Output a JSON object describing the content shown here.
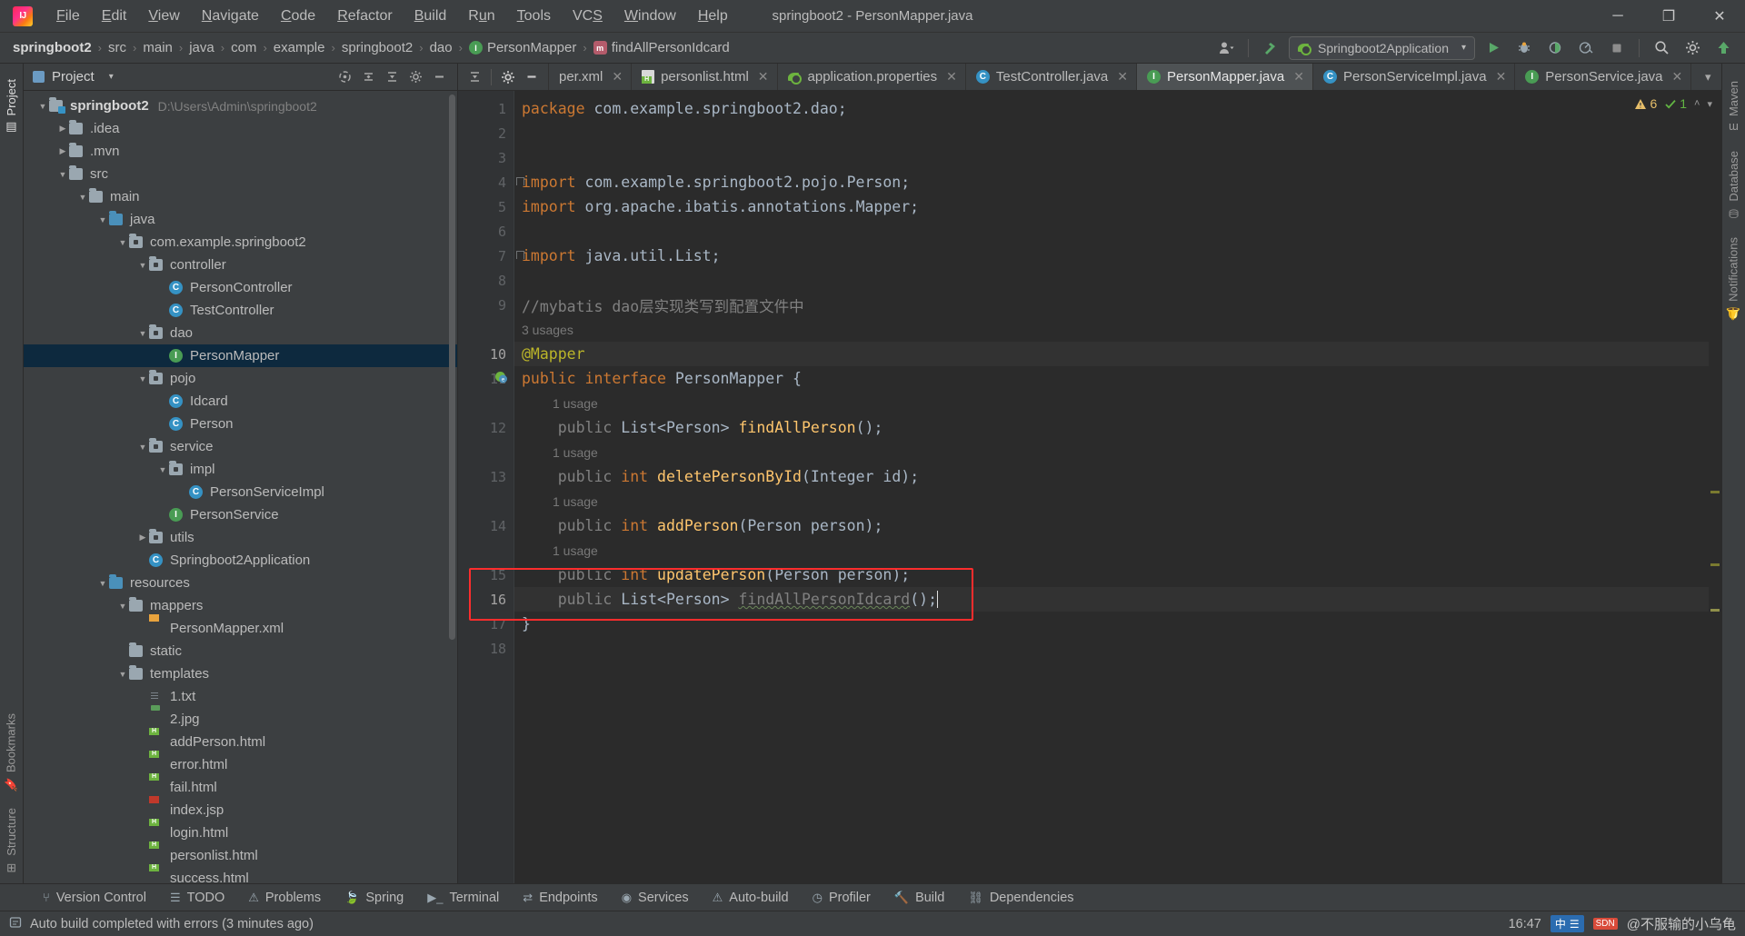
{
  "window": {
    "title": "springboot2 - PersonMapper.java",
    "logo_icon": "intellij-idea-logo",
    "controls": {
      "minimize": "─",
      "maximize": "❐",
      "close": "✕"
    }
  },
  "menubar": {
    "items": [
      {
        "label": "File",
        "mnemonic": "F"
      },
      {
        "label": "Edit",
        "mnemonic": "E"
      },
      {
        "label": "View",
        "mnemonic": "V"
      },
      {
        "label": "Navigate",
        "mnemonic": "N"
      },
      {
        "label": "Code",
        "mnemonic": "C"
      },
      {
        "label": "Refactor",
        "mnemonic": "R"
      },
      {
        "label": "Build",
        "mnemonic": "B"
      },
      {
        "label": "Run",
        "mnemonic": "u"
      },
      {
        "label": "Tools",
        "mnemonic": "T"
      },
      {
        "label": "VCS",
        "mnemonic": "S"
      },
      {
        "label": "Window",
        "mnemonic": "W"
      },
      {
        "label": "Help",
        "mnemonic": "H"
      }
    ]
  },
  "breadcrumbs": {
    "items": [
      {
        "label": "springboot2",
        "icon": null,
        "root": true
      },
      {
        "label": "src",
        "icon": null
      },
      {
        "label": "main",
        "icon": null
      },
      {
        "label": "java",
        "icon": null
      },
      {
        "label": "com",
        "icon": null
      },
      {
        "label": "example",
        "icon": null
      },
      {
        "label": "springboot2",
        "icon": null
      },
      {
        "label": "dao",
        "icon": null
      },
      {
        "label": "PersonMapper",
        "icon": "interface-icon"
      },
      {
        "label": "findAllPersonIdcard",
        "icon": "method-icon"
      }
    ],
    "separator": "›"
  },
  "toolbar": {
    "account_icon": "user-account-icon",
    "account_caret": "▾",
    "build_hammer_icon": "hammer-icon",
    "run_config": {
      "icon": "spring-boot-icon",
      "label": "Springboot2Application",
      "caret": "▾"
    },
    "run_icon": "run-play-icon",
    "debug_icon": "debug-bug-icon",
    "run_with_coverage_icon": "run-coverage-icon",
    "profiler_icon": "profiler-icon",
    "stop_icon": "stop-square-icon",
    "search_icon": "search-magnifier-icon",
    "settings_icon": "settings-gear-icon",
    "updates_icon": "green-arrow-icon"
  },
  "left_strip": {
    "tabs": [
      {
        "label": "Project",
        "icon": "project-folder-icon",
        "selected": true
      },
      {
        "label": "Bookmarks",
        "icon": "bookmark-icon",
        "selected": false
      },
      {
        "label": "Structure",
        "icon": "structure-icon",
        "selected": false
      }
    ]
  },
  "right_strip": {
    "tabs": [
      {
        "label": "Maven",
        "icon": "maven-icon"
      },
      {
        "label": "Database",
        "icon": "database-icon"
      },
      {
        "label": "Notifications",
        "icon": "notification-bell-icon"
      }
    ]
  },
  "project_panel": {
    "title": "Project",
    "title_caret": "▾",
    "actions": [
      {
        "icon": "sync-icon",
        "name": "reload-from-disk"
      },
      {
        "icon": "collapse-all-icon",
        "name": "collapse-all"
      },
      {
        "icon": "select-opened-file-icon",
        "name": "select-opened-file"
      },
      {
        "icon": "settings-gear-icon",
        "name": "project-settings"
      },
      {
        "icon": "hide-icon",
        "name": "hide-panel"
      }
    ],
    "tree": [
      {
        "label": "springboot2",
        "path": "D:\\Users\\Admin\\springboot2",
        "depth": 0,
        "arrow": "down",
        "icon": "module-folder",
        "bold": true,
        "selected": false
      },
      {
        "label": ".idea",
        "depth": 1,
        "arrow": "right",
        "icon": "folder",
        "selected": false
      },
      {
        "label": ".mvn",
        "depth": 1,
        "arrow": "right",
        "icon": "folder",
        "selected": false
      },
      {
        "label": "src",
        "depth": 1,
        "arrow": "down",
        "icon": "folder",
        "selected": false
      },
      {
        "label": "main",
        "depth": 2,
        "arrow": "down",
        "icon": "folder",
        "selected": false
      },
      {
        "label": "java",
        "depth": 3,
        "arrow": "down",
        "icon": "source-folder",
        "selected": false
      },
      {
        "label": "com.example.springboot2",
        "depth": 4,
        "arrow": "down",
        "icon": "package",
        "selected": false
      },
      {
        "label": "controller",
        "depth": 5,
        "arrow": "down",
        "icon": "package",
        "selected": false
      },
      {
        "label": "PersonController",
        "depth": 6,
        "arrow": "none",
        "icon": "class",
        "selected": false
      },
      {
        "label": "TestController",
        "depth": 6,
        "arrow": "none",
        "icon": "class",
        "selected": false
      },
      {
        "label": "dao",
        "depth": 5,
        "arrow": "down",
        "icon": "package",
        "selected": false
      },
      {
        "label": "PersonMapper",
        "depth": 6,
        "arrow": "none",
        "icon": "interface",
        "selected": true
      },
      {
        "label": "pojo",
        "depth": 5,
        "arrow": "down",
        "icon": "package",
        "selected": false
      },
      {
        "label": "Idcard",
        "depth": 6,
        "arrow": "none",
        "icon": "class",
        "selected": false
      },
      {
        "label": "Person",
        "depth": 6,
        "arrow": "none",
        "icon": "class",
        "selected": false
      },
      {
        "label": "service",
        "depth": 5,
        "arrow": "down",
        "icon": "package",
        "selected": false
      },
      {
        "label": "impl",
        "depth": 6,
        "arrow": "down",
        "icon": "package",
        "selected": false
      },
      {
        "label": "PersonServiceImpl",
        "depth": 7,
        "arrow": "none",
        "icon": "class",
        "selected": false
      },
      {
        "label": "PersonService",
        "depth": 6,
        "arrow": "none",
        "icon": "interface",
        "selected": false
      },
      {
        "label": "utils",
        "depth": 5,
        "arrow": "right",
        "icon": "package",
        "selected": false
      },
      {
        "label": "Springboot2Application",
        "depth": 5,
        "arrow": "none",
        "icon": "class",
        "selected": false
      },
      {
        "label": "resources",
        "depth": 3,
        "arrow": "down",
        "icon": "source-folder",
        "selected": false
      },
      {
        "label": "mappers",
        "depth": 4,
        "arrow": "down",
        "icon": "folder",
        "selected": false
      },
      {
        "label": "PersonMapper.xml",
        "depth": 5,
        "arrow": "none",
        "icon": "xml",
        "selected": false
      },
      {
        "label": "static",
        "depth": 4,
        "arrow": "none",
        "icon": "folder",
        "selected": false
      },
      {
        "label": "templates",
        "depth": 4,
        "arrow": "down",
        "icon": "folder",
        "selected": false
      },
      {
        "label": "1.txt",
        "depth": 5,
        "arrow": "none",
        "icon": "txt",
        "selected": false
      },
      {
        "label": "2.jpg",
        "depth": 5,
        "arrow": "none",
        "icon": "jpg",
        "selected": false
      },
      {
        "label": "addPerson.html",
        "depth": 5,
        "arrow": "none",
        "icon": "html",
        "selected": false
      },
      {
        "label": "error.html",
        "depth": 5,
        "arrow": "none",
        "icon": "html",
        "selected": false
      },
      {
        "label": "fail.html",
        "depth": 5,
        "arrow": "none",
        "icon": "html",
        "selected": false
      },
      {
        "label": "index.jsp",
        "depth": 5,
        "arrow": "none",
        "icon": "jsp",
        "selected": false
      },
      {
        "label": "login.html",
        "depth": 5,
        "arrow": "none",
        "icon": "html",
        "selected": false
      },
      {
        "label": "personlist.html",
        "depth": 5,
        "arrow": "none",
        "icon": "html",
        "selected": false
      },
      {
        "label": "success.html",
        "depth": 5,
        "arrow": "none",
        "icon": "html",
        "selected": false
      }
    ]
  },
  "editor": {
    "tabs": [
      {
        "label": "per.xml",
        "icon": "xml-icon",
        "active": false,
        "truncated": true
      },
      {
        "label": "personlist.html",
        "icon": "html-icon",
        "active": false
      },
      {
        "label": "application.properties",
        "icon": "spring-icon",
        "active": false
      },
      {
        "label": "TestController.java",
        "icon": "class-icon",
        "active": false
      },
      {
        "label": "PersonMapper.java",
        "icon": "interface-icon",
        "active": true
      },
      {
        "label": "PersonServiceImpl.java",
        "icon": "class-icon",
        "active": false
      },
      {
        "label": "PersonService.java",
        "icon": "interface-icon",
        "active": false
      }
    ],
    "tab_close": "✕",
    "tab_overflow_left": "‹",
    "tab_list_icon": "▾",
    "tab_more_icon": "⋮",
    "inspection": {
      "warning_count": "6",
      "warning_icon": "warning-triangle-icon",
      "error_fixed_count": "1",
      "check_icon": "checkmark-icon",
      "caret_down": "▾",
      "caret_up": "˄"
    },
    "lines": [
      {
        "num": "1",
        "segments": [
          {
            "t": "package ",
            "c": "kw"
          },
          {
            "t": "com.example.springboot2.dao;",
            "c": "typ"
          }
        ]
      },
      {
        "num": "2",
        "segments": []
      },
      {
        "num": "3",
        "segments": []
      },
      {
        "num": "4",
        "fold": true,
        "segments": [
          {
            "t": "import ",
            "c": "kw"
          },
          {
            "t": "com.example.springboot2.pojo.Person;",
            "c": "typ"
          }
        ]
      },
      {
        "num": "5",
        "segments": [
          {
            "t": "import ",
            "c": "kw"
          },
          {
            "t": "org.apache.ibatis.annotations.",
            "c": "typ"
          },
          {
            "t": "Mapper",
            "c": "cls"
          },
          {
            "t": ";",
            "c": "typ"
          }
        ]
      },
      {
        "num": "6",
        "segments": []
      },
      {
        "num": "7",
        "fold": true,
        "segments": [
          {
            "t": "import ",
            "c": "kw"
          },
          {
            "t": "java.util.List;",
            "c": "typ"
          }
        ]
      },
      {
        "num": "8",
        "segments": []
      },
      {
        "num": "9",
        "segments": [
          {
            "t": "//mybatis dao层实现类写到配置文件中",
            "c": "cmt"
          }
        ]
      },
      {
        "num": "",
        "hint": "3 usages"
      },
      {
        "num": "10",
        "current": true,
        "segments": [
          {
            "t": "@Mapper",
            "c": "ann"
          }
        ]
      },
      {
        "num": "11",
        "marker": "spring-bean-icon",
        "segments": [
          {
            "t": "public interface ",
            "c": "kw"
          },
          {
            "t": "PersonMapper ",
            "c": "cls"
          },
          {
            "t": "{",
            "c": "punc"
          }
        ]
      },
      {
        "num": "",
        "hint": "1 usage",
        "indent": 1
      },
      {
        "num": "12",
        "segments": [
          {
            "t": "    public ",
            "c": "dim"
          },
          {
            "t": "List",
            "c": "cls"
          },
          {
            "t": "<",
            "c": "punc"
          },
          {
            "t": "Person",
            "c": "cls"
          },
          {
            "t": "> ",
            "c": "punc"
          },
          {
            "t": "findAllPerson",
            "c": "mth"
          },
          {
            "t": "();",
            "c": "punc"
          }
        ]
      },
      {
        "num": "",
        "hint": "1 usage",
        "indent": 1
      },
      {
        "num": "13",
        "segments": [
          {
            "t": "    public ",
            "c": "dim"
          },
          {
            "t": "int ",
            "c": "kw"
          },
          {
            "t": "deletePersonById",
            "c": "mth"
          },
          {
            "t": "(",
            "c": "punc"
          },
          {
            "t": "Integer",
            "c": "cls"
          },
          {
            "t": " id);",
            "c": "punc"
          }
        ]
      },
      {
        "num": "",
        "hint": "1 usage",
        "indent": 1
      },
      {
        "num": "14",
        "segments": [
          {
            "t": "    public ",
            "c": "dim"
          },
          {
            "t": "int ",
            "c": "kw"
          },
          {
            "t": "addPerson",
            "c": "mth"
          },
          {
            "t": "(",
            "c": "punc"
          },
          {
            "t": "Person",
            "c": "cls"
          },
          {
            "t": " person);",
            "c": "punc"
          }
        ]
      },
      {
        "num": "",
        "hint": "1 usage",
        "indent": 1
      },
      {
        "num": "15",
        "segments": [
          {
            "t": "    public ",
            "c": "dim"
          },
          {
            "t": "int ",
            "c": "kw"
          },
          {
            "t": "updatePerson",
            "c": "mth"
          },
          {
            "t": "(",
            "c": "punc"
          },
          {
            "t": "Person",
            "c": "cls"
          },
          {
            "t": " person);",
            "c": "punc"
          }
        ]
      },
      {
        "num": "16",
        "current": true,
        "caret": true,
        "segments": [
          {
            "t": "    public ",
            "c": "dim"
          },
          {
            "t": "List",
            "c": "cls"
          },
          {
            "t": "<",
            "c": "punc"
          },
          {
            "t": "Person",
            "c": "cls"
          },
          {
            "t": "> ",
            "c": "punc"
          },
          {
            "t": "findAllPersonIdcard",
            "c": "dim",
            "squiggle": true
          },
          {
            "t": "();",
            "c": "punc"
          }
        ]
      },
      {
        "num": "17",
        "segments": [
          {
            "t": "}",
            "c": "punc"
          }
        ]
      },
      {
        "num": "18",
        "segments": []
      }
    ],
    "annotation_box_color": "#ff2d2d"
  },
  "bottom_toolwindows": [
    {
      "label": "Version Control",
      "icon": "version-control-icon"
    },
    {
      "label": "TODO",
      "icon": "todo-list-icon"
    },
    {
      "label": "Problems",
      "icon": "problems-warning-icon"
    },
    {
      "label": "Spring",
      "icon": "spring-leaf-icon"
    },
    {
      "label": "Terminal",
      "icon": "terminal-icon"
    },
    {
      "label": "Endpoints",
      "icon": "endpoints-icon"
    },
    {
      "label": "Services",
      "icon": "services-icon"
    },
    {
      "label": "Auto-build",
      "icon": "auto-build-icon"
    },
    {
      "label": "Profiler",
      "icon": "profiler-icon"
    },
    {
      "label": "Build",
      "icon": "build-hammer-icon"
    },
    {
      "label": "Dependencies",
      "icon": "dependencies-icon"
    }
  ],
  "statusbar": {
    "icon": "build-status-icon",
    "message": "Auto build completed with errors (3 minutes ago)",
    "clock": "16:47",
    "ime_label": "中",
    "ime_extra": "☰",
    "watermark": "@不服输的小乌龟",
    "sdn_badge": "SDN"
  },
  "colors": {
    "accent_blue": "#3592c4",
    "interface_green": "#499c54",
    "keyword_orange": "#cc7832",
    "method_yellow": "#ffc66d",
    "annotation_yellow": "#bbb529",
    "selection_blue": "#0d293e",
    "annotation_red": "#ff2d2d",
    "editor_bg": "#2b2b2b",
    "panel_bg": "#3c3f41"
  }
}
